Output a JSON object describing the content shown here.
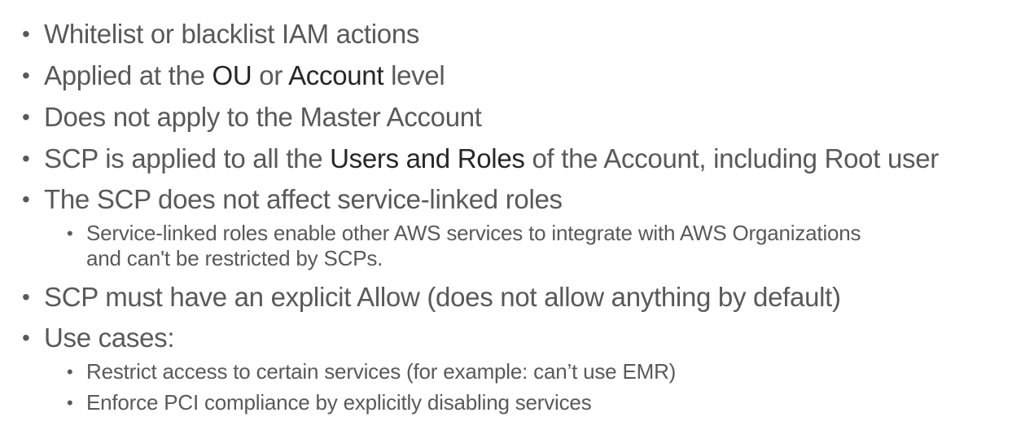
{
  "bullets": [
    {
      "parts": [
        "Whitelist or blacklist IAM actions"
      ]
    },
    {
      "parts": [
        "Applied at the ",
        "OU",
        " or ",
        "Account",
        " level"
      ]
    },
    {
      "parts": [
        "Does not apply to the Master Account"
      ]
    },
    {
      "parts": [
        "SCP is applied to all the ",
        "Users and Roles",
        " of the Account, including Root user"
      ]
    },
    {
      "parts": [
        "The SCP does not affect service-linked roles"
      ]
    },
    {
      "parts": [
        "SCP must have an explicit Allow (does not allow anything by default)"
      ]
    },
    {
      "parts": [
        "Use cases:"
      ]
    }
  ],
  "sub_bullets": [
    {
      "lines": [
        "Service-linked roles enable other AWS services to integrate with AWS Organizations",
        "and can't be restricted by SCPs."
      ]
    },
    {
      "lines": [
        "Restrict access to certain services (for example: can’t use EMR)"
      ]
    },
    {
      "lines": [
        "Enforce PCI compliance by explicitly disabling services"
      ]
    }
  ],
  "bullet_glyph": "•",
  "colors": {
    "text": "#595959",
    "emphasis": "#262626",
    "background": "#ffffff"
  }
}
